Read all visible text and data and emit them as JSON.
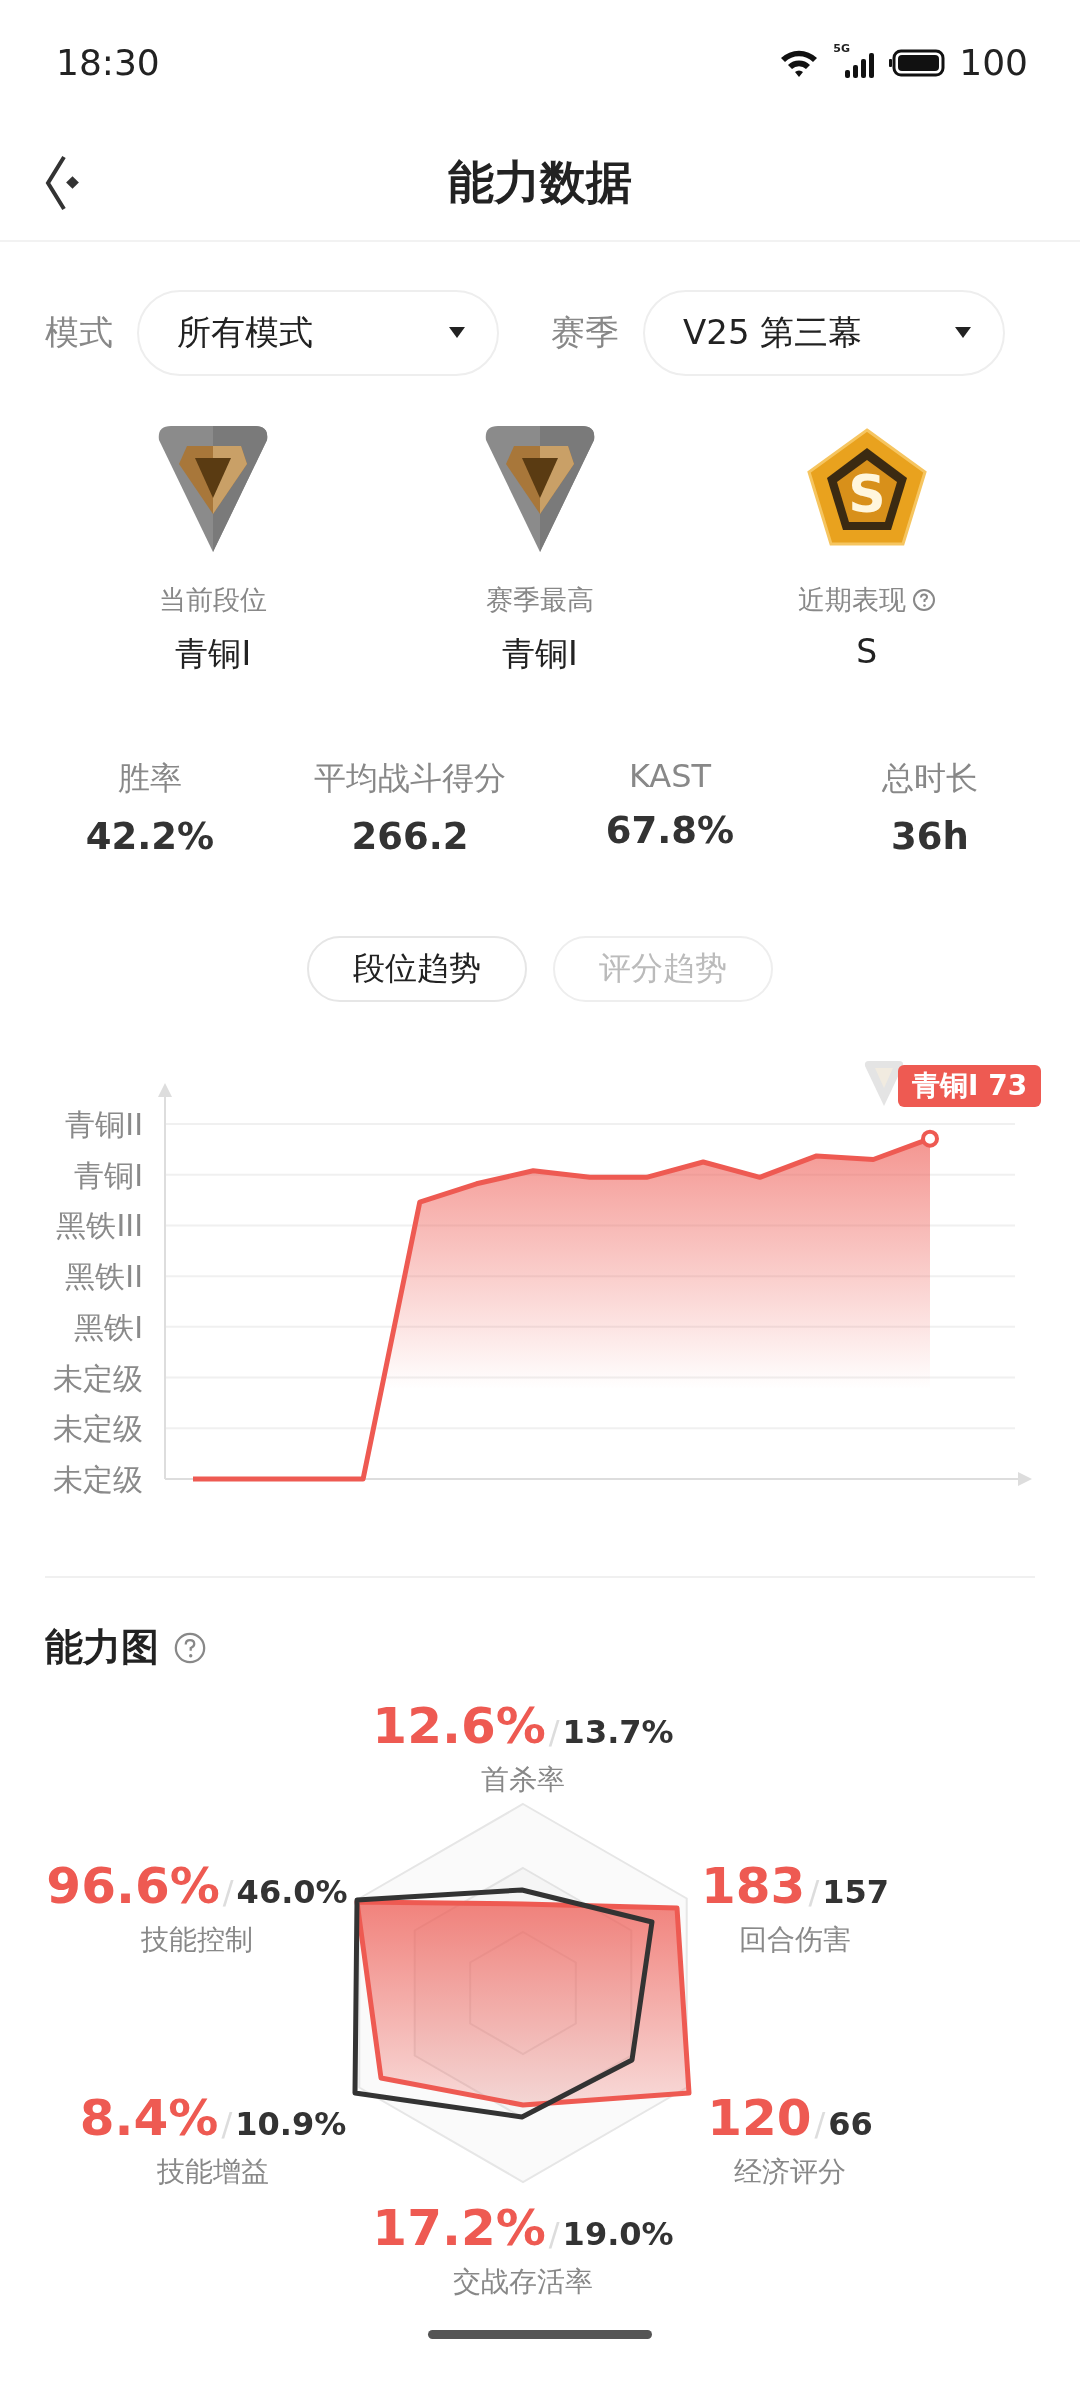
{
  "status_bar": {
    "time": "18:30",
    "network": "5G",
    "battery": "100"
  },
  "header": {
    "title": "能力数据"
  },
  "filters": [
    {
      "label": "模式",
      "value": "所有模式"
    },
    {
      "label": "赛季",
      "value": "V25 第三幕"
    }
  ],
  "ranks": [
    {
      "kind": "tier",
      "label": "当前段位",
      "value": "青铜I",
      "help": false
    },
    {
      "kind": "tier",
      "label": "赛季最高",
      "value": "青铜I",
      "help": false
    },
    {
      "kind": "performance",
      "emblem": "S",
      "label": "近期表现",
      "value": "S",
      "help": true
    }
  ],
  "stats": [
    {
      "label": "胜率",
      "value": "42.2%"
    },
    {
      "label": "平均战斗得分",
      "value": "266.2"
    },
    {
      "label": "KAST",
      "value": "67.8%"
    },
    {
      "label": "总时长",
      "value": "36h"
    }
  ],
  "trend_tabs": [
    {
      "label": "段位趋势",
      "selected": true
    },
    {
      "label": "评分趋势",
      "selected": false
    }
  ],
  "trend_chart": {
    "current_tag": "青铜I 73",
    "axis_labels": [
      "青铜II",
      "青铜I",
      "黑铁III",
      "黑铁II",
      "黑铁I",
      "未定级",
      "未定级",
      "未定级"
    ],
    "kind": "picture"
  },
  "ability": {
    "title": "能力图",
    "help": true,
    "stats": [
      {
        "name": "首杀率",
        "value": "12.6%",
        "separator": "/",
        "average": "13.7%"
      },
      {
        "name": "技能控制",
        "value": "96.6%",
        "separator": "/",
        "average": "46.0%"
      },
      {
        "name": "回合伤害",
        "value": "183",
        "separator": "/",
        "average": "157"
      },
      {
        "name": "技能增益",
        "value": "8.4%",
        "separator": "/",
        "average": "10.9%"
      },
      {
        "name": "经济评分",
        "value": "120",
        "separator": "/",
        "average": "66"
      },
      {
        "name": "交战存活率",
        "value": "17.2%",
        "separator": "/",
        "average": "19.0%"
      }
    ]
  }
}
